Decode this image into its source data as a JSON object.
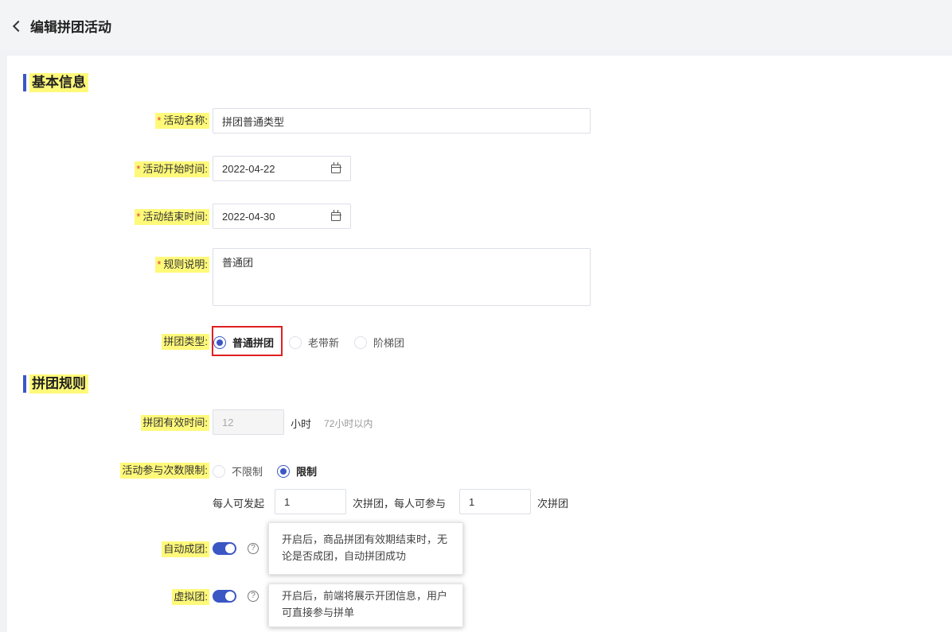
{
  "header": {
    "title": "编辑拼团活动"
  },
  "sections": {
    "basic": "基本信息",
    "rules": "拼团规则"
  },
  "form": {
    "name": {
      "label": "活动名称:",
      "value": "拼团普通类型"
    },
    "start": {
      "label": "活动开始时间:",
      "value": "2022-04-22"
    },
    "end": {
      "label": "活动结束时间:",
      "value": "2022-04-30"
    },
    "desc": {
      "label": "规则说明:",
      "value": "普通团"
    },
    "type": {
      "label": "拼团类型:",
      "options": [
        "普通拼团",
        "老带新",
        "阶梯团"
      ],
      "selected": "普通拼团"
    },
    "valid": {
      "label": "拼团有效时间:",
      "value": "12",
      "unit": "小时",
      "hint": "72小时以内"
    },
    "limit": {
      "label": "活动参与次数限制:",
      "options": [
        "不限制",
        "限制"
      ],
      "selected": "限制",
      "text1": "每人可发起",
      "value1": "1",
      "text2": "次拼团，每人可参与",
      "value2": "1",
      "text3": "次拼团"
    },
    "auto": {
      "label": "自动成团:",
      "enabled": true,
      "tooltip_line1": "开启后，商品拼团有效期结束时，无",
      "tooltip_line2": "论是否成团，自动拼团成功"
    },
    "virtual": {
      "label": "虚拟团:",
      "enabled": true,
      "tooltip_line1": "开启后，前端将展示开团信息，用户",
      "tooltip_line2": "可直接参与拼单"
    }
  },
  "colors": {
    "accent": "#3a57c4",
    "highlight": "#fff97a",
    "required": "#e4393c"
  }
}
